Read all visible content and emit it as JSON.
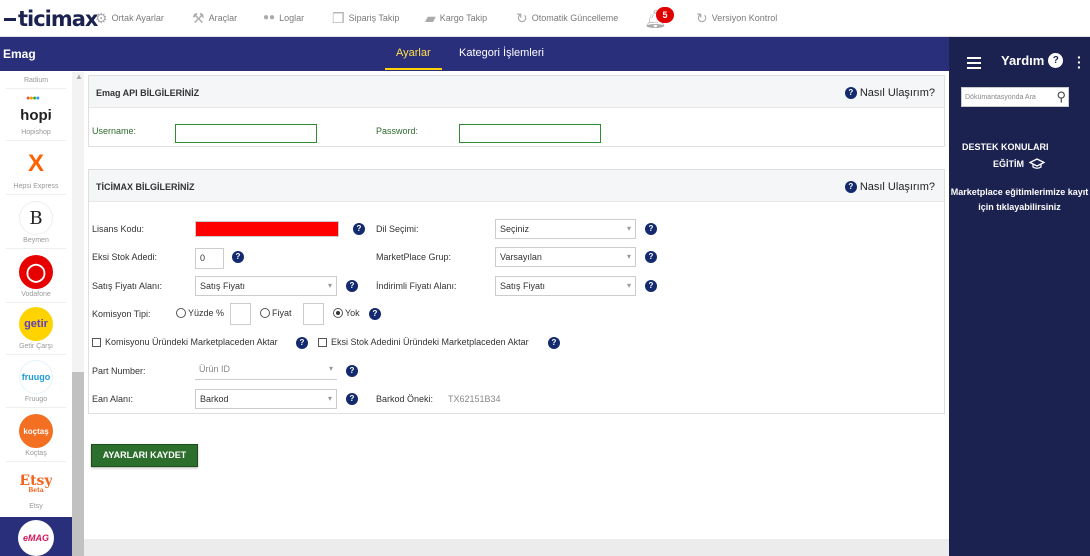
{
  "topbar": {
    "logo": "ticimax",
    "items": [
      {
        "label": "Ortak Ayarlar",
        "icon": "gear-icon"
      },
      {
        "label": "Araçlar",
        "icon": "tools-icon"
      },
      {
        "label": "Loglar",
        "icon": "log-icon"
      },
      {
        "label": "Sipariş Takip",
        "icon": "box-icon"
      },
      {
        "label": "Kargo Takip",
        "icon": "truck-icon"
      },
      {
        "label": "Otomatik Güncelleme",
        "icon": "sync-icon"
      },
      {
        "label": "Versiyon Kontrol",
        "icon": "sync-icon"
      }
    ],
    "notification_count": "5"
  },
  "left_panel": {
    "title": "Emag",
    "marketplaces": [
      {
        "name": "Radium"
      },
      {
        "name": "Hopishop",
        "logo_text": "hopi"
      },
      {
        "name": "Hepsi Express",
        "logo_text": "X"
      },
      {
        "name": "Beymen",
        "logo_text": "B"
      },
      {
        "name": "Vodafone",
        "logo_text": "◯"
      },
      {
        "name": "Getir Çarşı",
        "logo_text": "getir"
      },
      {
        "name": "Fruugo",
        "logo_text": "fruugo"
      },
      {
        "name": "Koçtaş",
        "logo_text": "koçtaş"
      },
      {
        "name": "Etsy",
        "logo_text": "Etsy",
        "logo_sub": "Beta"
      }
    ],
    "selected_logo": "eMAG"
  },
  "nav": {
    "tabs": [
      {
        "label": "Ayarlar",
        "active": true
      },
      {
        "label": "Kategori İşlemleri",
        "active": false
      }
    ]
  },
  "api_section": {
    "title": "Emag API BİLGİLERİNİZ",
    "help": "Nasıl Ulaşırım?",
    "username_label": "Username:",
    "username_value": "",
    "password_label": "Password:",
    "password_value": ""
  },
  "ticimax_section": {
    "title": "TİCİMAX BİLGİLERİNİZ",
    "help": "Nasıl Ulaşırım?",
    "lisans_label": "Lisans Kodu:",
    "dil_label": "Dil Seçimi:",
    "dil_value": "Seçiniz",
    "eksi_stok_label": "Eksi Stok Adedi:",
    "eksi_stok_value": "0",
    "mp_grup_label": "MarketPlace Grup:",
    "mp_grup_value": "Varsayılan",
    "satis_label": "Satış Fiyatı Alanı:",
    "satis_value": "Satış Fiyatı",
    "indirimli_label": "İndirimli Fiyatı Alanı:",
    "indirimli_value": "Satış Fiyatı",
    "komisyon_label": "Komisyon Tipi:",
    "komisyon_options": [
      "Yüzde %",
      "Fiyat",
      "Yok"
    ],
    "komisyon_selected": "Yok",
    "chk1_label": "Komisyonu Üründeki Marketplaceden Aktar",
    "chk2_label": "Eksi Stok Adedini Üründeki Marketplaceden Aktar",
    "part_label": "Part Number:",
    "part_value": "Ürün ID",
    "ean_label": "Ean Alanı:",
    "ean_value": "Barkod",
    "barkod_onek_label": "Barkod Öneki:",
    "barkod_onek_value": "TX62151B34"
  },
  "save_button": "AYARLARI KAYDET",
  "right_panel": {
    "title": "Yardım",
    "search_placeholder": "Dökümantasyonda Ara",
    "destek": "DESTEK KONULARI",
    "egitim": "EĞİTİM",
    "message": "Marketplace eğitimlerimize kayıt için tıklayabilirsiniz"
  }
}
